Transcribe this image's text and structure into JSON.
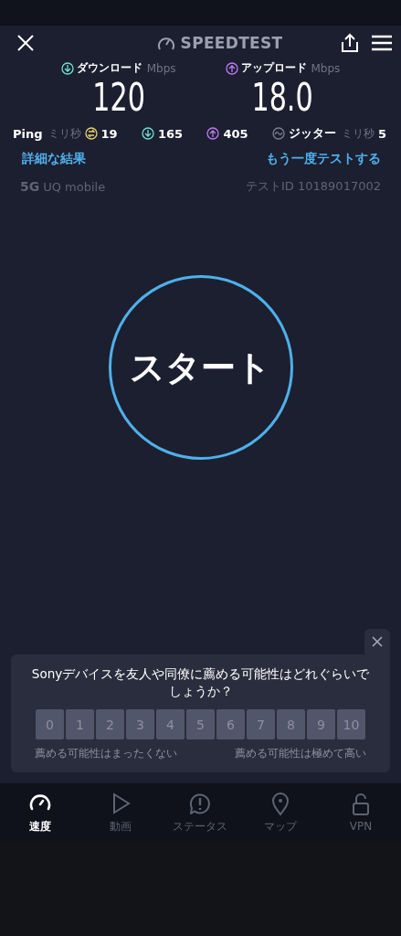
{
  "header": {
    "title": "SPEEDTEST"
  },
  "results": [
    {
      "kind": "download",
      "label": "ダウンロード",
      "unit": "Mbps",
      "value": "120",
      "color": "#6fe0d2"
    },
    {
      "kind": "upload",
      "label": "アップロード",
      "unit": "Mbps",
      "value": "18.0",
      "color": "#bf7cf2"
    }
  ],
  "ping": {
    "label": "Ping",
    "unit": "ミリ秒",
    "idle": "19",
    "download": "165",
    "upload": "405"
  },
  "jitter": {
    "label": "ジッター",
    "unit": "ミリ秒",
    "value": "5"
  },
  "links": [
    "詳細な結果",
    "もう一度テストする"
  ],
  "network": {
    "type": "5G",
    "carrier": "UQ mobile",
    "test_id": "テストID 10189017002"
  },
  "start_button": "スタート",
  "survey": {
    "question": "Sonyデバイスを友人や同僚に薦める可能性はどれぐらいでしょうか？",
    "scores": [
      "0",
      "1",
      "2",
      "3",
      "4",
      "5",
      "6",
      "7",
      "8",
      "9",
      "10"
    ],
    "low_label": "薦める可能性はまったくない",
    "high_label": "薦める可能性は極めて高い"
  },
  "nav": [
    {
      "kind": "speed",
      "label": "速度",
      "selected": true
    },
    {
      "kind": "video",
      "label": "動画",
      "selected": false
    },
    {
      "kind": "status",
      "label": "ステータス",
      "selected": false
    },
    {
      "kind": "map",
      "label": "マップ",
      "selected": false
    },
    {
      "kind": "vpn",
      "label": "VPN",
      "selected": false
    }
  ]
}
